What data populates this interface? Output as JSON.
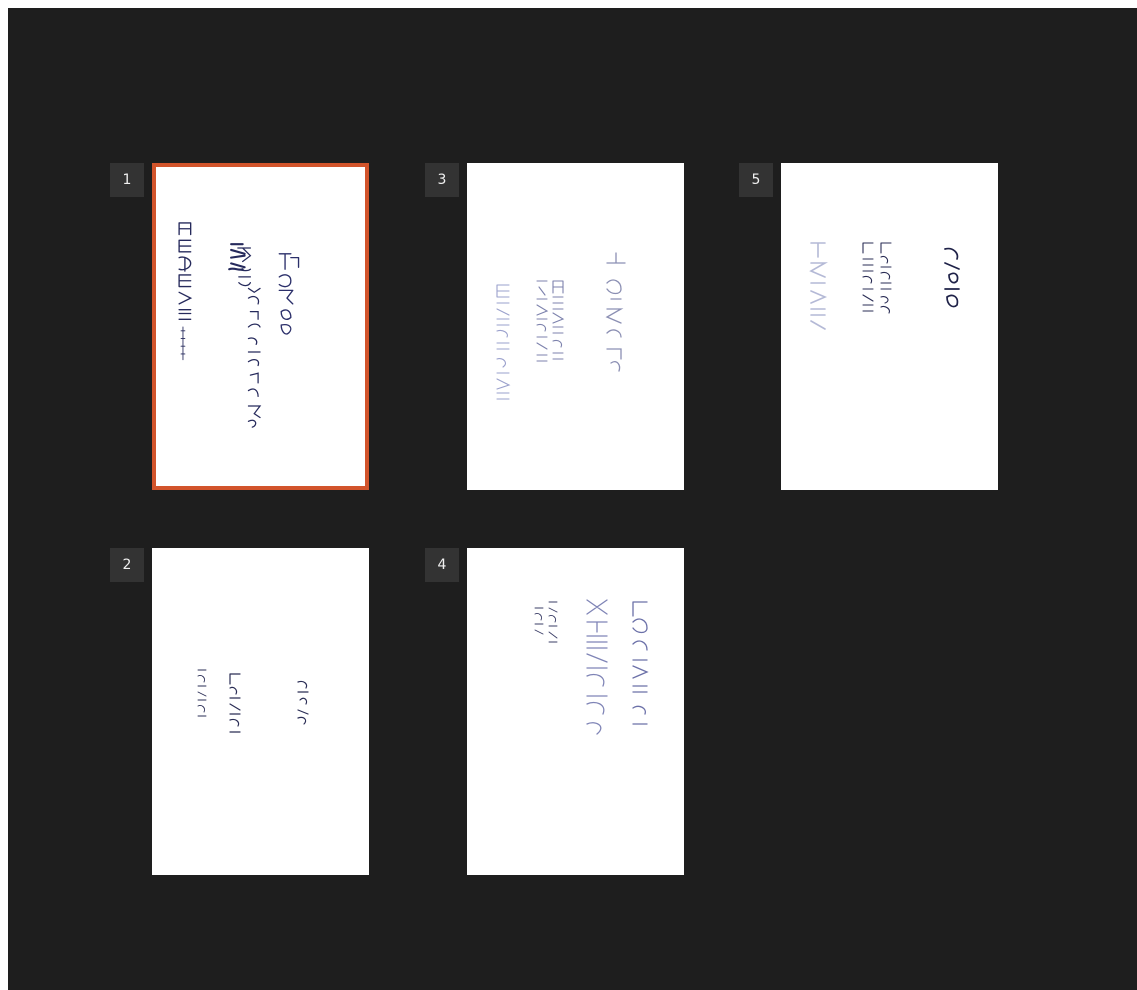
{
  "pages": [
    {
      "number": "1",
      "selected": true
    },
    {
      "number": "2",
      "selected": false
    },
    {
      "number": "3",
      "selected": false
    },
    {
      "number": "4",
      "selected": false
    },
    {
      "number": "5",
      "selected": false
    }
  ],
  "colors": {
    "background": "#1e1e1e",
    "badge": "#333333",
    "selection": "#d2542b",
    "page": "#ffffff"
  }
}
